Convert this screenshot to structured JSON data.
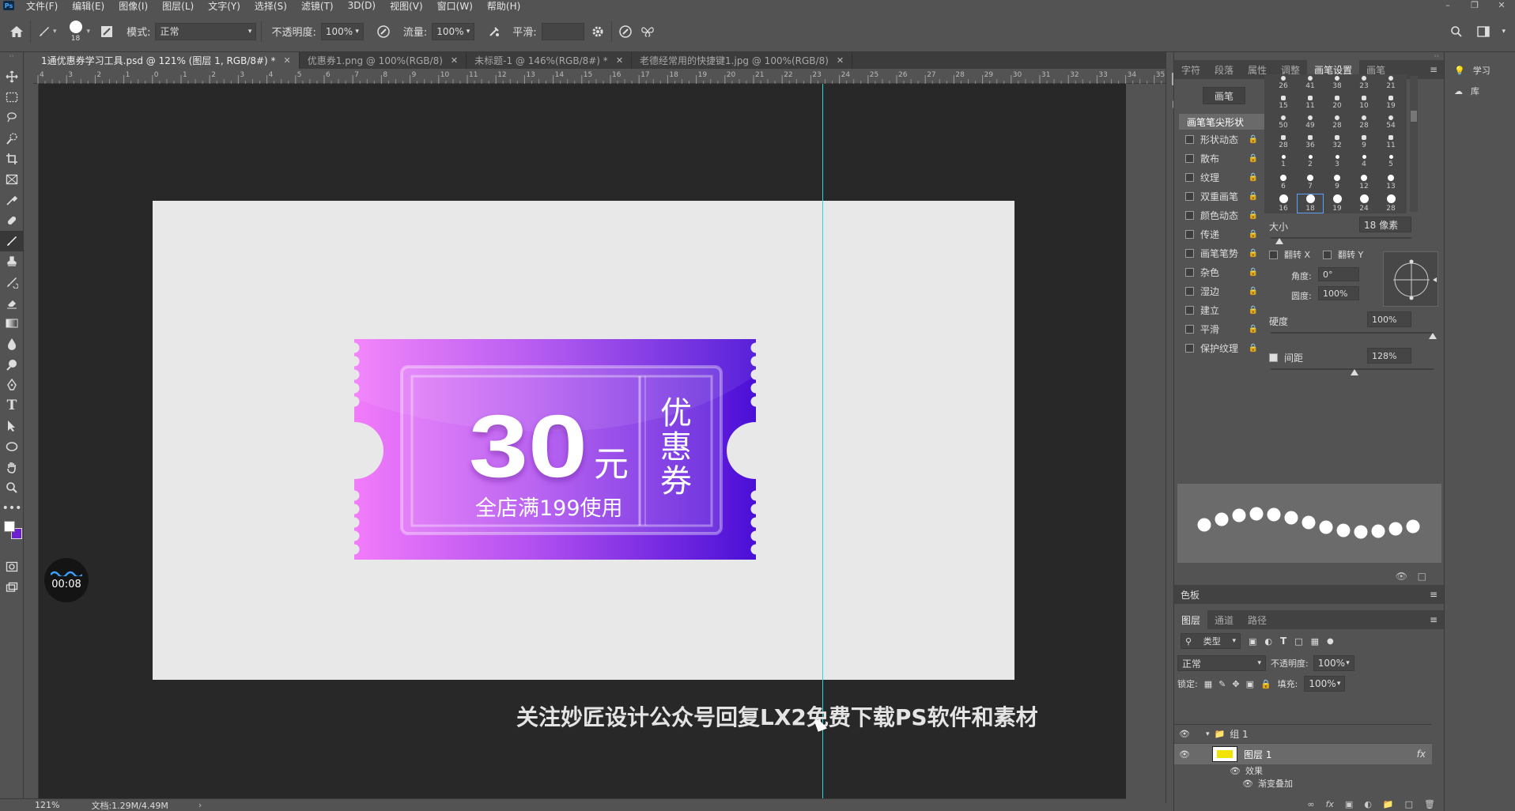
{
  "menu": [
    "文件(F)",
    "编辑(E)",
    "图像(I)",
    "图层(L)",
    "文字(Y)",
    "选择(S)",
    "滤镜(T)",
    "3D(D)",
    "视图(V)",
    "窗口(W)",
    "帮助(H)"
  ],
  "app_icon": "Ps",
  "options": {
    "brush_size": "18",
    "mode_label": "模式:",
    "mode_value": "正常",
    "opacity_label": "不透明度:",
    "opacity_value": "100%",
    "flow_label": "流量:",
    "flow_value": "100%",
    "smooth_label": "平滑:"
  },
  "tabs": [
    {
      "label": "1通优惠券学习工具.psd @ 121% (图层 1, RGB/8#) *",
      "active": true
    },
    {
      "label": "优惠券1.png @ 100%(RGB/8)",
      "active": false
    },
    {
      "label": "未标题-1 @ 146%(RGB/8#) *",
      "active": false
    },
    {
      "label": "老德经常用的快捷键1.jpg @ 100%(RGB/8)",
      "active": false
    }
  ],
  "ruler_h": [
    "4",
    "3",
    "2",
    "1",
    "0",
    "1",
    "2",
    "3",
    "4",
    "5",
    "6",
    "7",
    "8",
    "9",
    "10",
    "11",
    "12",
    "13",
    "14",
    "15",
    "16",
    "17",
    "18",
    "19",
    "20",
    "21",
    "22",
    "23",
    "24",
    "25",
    "26",
    "27",
    "28",
    "29",
    "30",
    "31",
    "32",
    "33",
    "34",
    "35"
  ],
  "coupon": {
    "amount": "30",
    "unit": "元",
    "condition": "全店满199使用",
    "side_text": [
      "优",
      "惠",
      "券"
    ],
    "color_start": "#f27cfa",
    "color_end": "#4a0fd6"
  },
  "watermark": "关注妙匠设计公众号回复LX2免费下载PS软件和素材",
  "timer": "00:08",
  "status": {
    "zoom": "121%",
    "doc": "文档:1.29M/4.49M"
  },
  "brush_panel": {
    "tabs": [
      "字符",
      "段落",
      "属性",
      "调整",
      "画笔设置",
      "画笔"
    ],
    "active_tab": "画笔设置",
    "brush_button": "画笔",
    "tip_shape": "画笔笔尖形状",
    "options": [
      {
        "label": "形状动态",
        "checked": false
      },
      {
        "label": "散布",
        "checked": false
      },
      {
        "label": "纹理",
        "checked": false
      },
      {
        "label": "双重画笔",
        "checked": false
      },
      {
        "label": "颜色动态",
        "checked": false
      },
      {
        "label": "传递",
        "checked": false
      },
      {
        "label": "画笔笔势",
        "checked": false
      },
      {
        "label": "杂色",
        "checked": false
      },
      {
        "label": "湿边",
        "checked": false
      },
      {
        "label": "建立",
        "checked": false
      },
      {
        "label": "平滑",
        "checked": false
      },
      {
        "label": "保护纹理",
        "checked": false
      }
    ],
    "tip_rows": [
      [
        "26",
        "41",
        "38",
        "23",
        "21"
      ],
      [
        "15",
        "11",
        "20",
        "10",
        "19"
      ],
      [
        "50",
        "49",
        "28",
        "28",
        "54"
      ],
      [
        "28",
        "36",
        "32",
        "9",
        "11"
      ],
      [
        "1",
        "2",
        "3",
        "4",
        "5"
      ],
      [
        "6",
        "7",
        "9",
        "12",
        "13"
      ],
      [
        "16",
        "18",
        "19",
        "24",
        "28"
      ]
    ],
    "size_label": "大小",
    "size_value": "18 像素",
    "flip_x": "翻转 X",
    "flip_y": "翻转 Y",
    "angle_label": "角度:",
    "angle_value": "0°",
    "roundness_label": "圆度:",
    "roundness_value": "100%",
    "hardness_label": "硬度",
    "hardness_value": "100%",
    "spacing_label": "间距",
    "spacing_value": "128%",
    "spacing_checked": true
  },
  "swatch_panel": {
    "title": "色板"
  },
  "layers_panel": {
    "tabs": [
      "图层",
      "通道",
      "路径"
    ],
    "filter": "类型",
    "blend": "正常",
    "opacity_label": "不透明度:",
    "opacity_value": "100%",
    "lock_label": "锁定:",
    "fill_label": "填充:",
    "fill_value": "100%",
    "rows": [
      {
        "name": "组 1",
        "kind": "group"
      },
      {
        "name": "图层 1",
        "kind": "layer"
      },
      {
        "name": "效果",
        "kind": "effects"
      },
      {
        "name": "渐变叠加",
        "kind": "effect"
      }
    ]
  },
  "right_panel": {
    "learn": "学习",
    "library": "库"
  }
}
